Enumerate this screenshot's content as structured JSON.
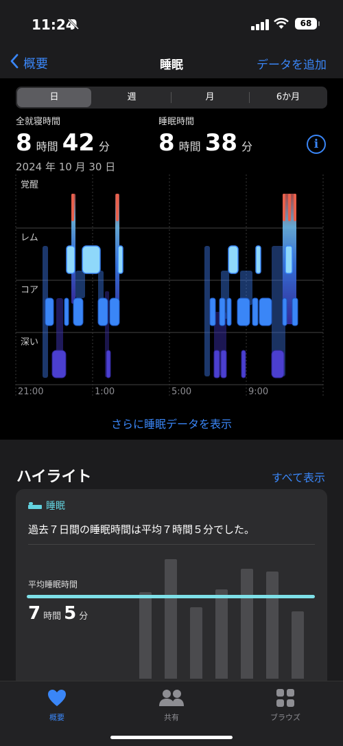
{
  "status": {
    "time": "11:24",
    "battery": "68"
  },
  "nav": {
    "back_label": "概要",
    "title": "睡眠",
    "action_label": "データを追加"
  },
  "segments": [
    "日",
    "週",
    "月",
    "6か月"
  ],
  "stats": {
    "in_bed_label": "全就寝時間",
    "in_bed_hours": "8",
    "in_bed_minutes": "42",
    "asleep_label": "睡眠時間",
    "asleep_hours": "8",
    "asleep_minutes": "38",
    "hour_unit": "時間",
    "minute_unit": "分",
    "date": "2024 年 10 月 30 日"
  },
  "chart_data": {
    "type": "sleep-stage-timeline",
    "stages": [
      "覚醒",
      "レム",
      "コア",
      "深い"
    ],
    "x_ticks": [
      "21:00",
      "1:00",
      "5:00",
      "9:00"
    ],
    "colors": {
      "awake": "#e8604c",
      "rem": "#7fd3f7",
      "core": "#3a86f7",
      "deep": "#4b3fd0"
    }
  },
  "more_link": "さらに睡眠データを表示",
  "highlights": {
    "title": "ハイライト",
    "show_all": "すべて表示",
    "card": {
      "category": "睡眠",
      "text": "過去７日間の睡眠時間は平均７時間５分でした。",
      "avg_label": "平均睡眠時間",
      "avg_hours": "7",
      "avg_minutes": "5",
      "hour_unit": "時間",
      "minute_unit": "分",
      "week_bars": [
        6.3,
        8.7,
        5.2,
        6.5,
        8.0,
        7.8,
        4.9
      ]
    }
  },
  "tabbar": {
    "items": [
      "概要",
      "共有",
      "ブラウズ"
    ]
  }
}
